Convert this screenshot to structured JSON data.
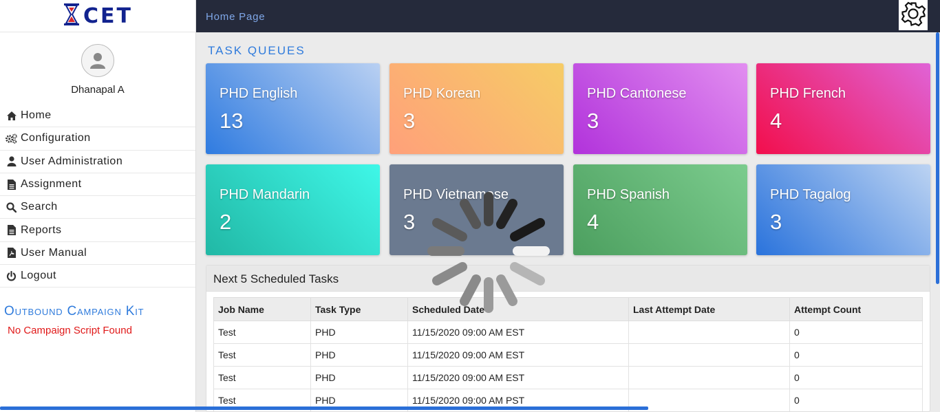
{
  "brand": {
    "name": "CET",
    "logo_icon": "hourglass-icon"
  },
  "profile": {
    "avatar_icon": "user-avatar-icon",
    "name": "Dhanapal A"
  },
  "menu": [
    {
      "label": "Home",
      "icon": "home-icon"
    },
    {
      "label": "Configuration",
      "icon": "cogs-icon"
    },
    {
      "label": "User Administration",
      "icon": "user-icon"
    },
    {
      "label": "Assignment",
      "icon": "file-icon"
    },
    {
      "label": "Search",
      "icon": "search-icon"
    },
    {
      "label": "Reports",
      "icon": "file-icon"
    },
    {
      "label": "User Manual",
      "icon": "pdf-file-icon"
    },
    {
      "label": "Logout",
      "icon": "power-icon"
    }
  ],
  "campaign": {
    "title": "Outbound Campaign Kit",
    "message": "No Campaign Script Found"
  },
  "topbar": {
    "title": "Home Page",
    "settings_icon": "gear-icon"
  },
  "task_queues": {
    "title": "TASK QUEUES",
    "cards": [
      {
        "label": "PHD English",
        "value": "13",
        "colors": [
          "#2f7be0",
          "#b9d0f2"
        ]
      },
      {
        "label": "PHD Korean",
        "value": "3",
        "colors": [
          "#ffa07a",
          "#f6cc66"
        ]
      },
      {
        "label": "PHD Cantonese",
        "value": "3",
        "colors": [
          "#b132db",
          "#e28ef0"
        ]
      },
      {
        "label": "PHD French",
        "value": "4",
        "colors": [
          "#f20e4c",
          "#e063d6"
        ]
      },
      {
        "label": "PHD Mandarin",
        "value": "2",
        "colors": [
          "#21b8a5",
          "#3ff7e8"
        ]
      },
      {
        "label": "PHD Vietnamese",
        "value": "3",
        "colors": [
          "#6b7a90",
          "#6b7a90"
        ]
      },
      {
        "label": "PHD Spanish",
        "value": "4",
        "colors": [
          "#4c9f5f",
          "#7ccc8e"
        ]
      },
      {
        "label": "PHD Tagalog",
        "value": "3",
        "colors": [
          "#2a73dc",
          "#bcd3f2"
        ]
      }
    ]
  },
  "scheduled": {
    "title": "Next 5 Scheduled Tasks",
    "columns": [
      "Job Name",
      "Task Type",
      "Scheduled Date",
      "Last Attempt Date",
      "Attempt Count"
    ],
    "rows": [
      [
        "Test",
        "PHD",
        "11/15/2020 09:00 AM EST",
        "",
        "0"
      ],
      [
        "Test",
        "PHD",
        "11/15/2020 09:00 AM EST",
        "",
        "0"
      ],
      [
        "Test",
        "PHD",
        "11/15/2020 09:00 AM EST",
        "",
        "0"
      ],
      [
        "Test",
        "PHD",
        "11/15/2020 09:00 AM PST",
        "",
        "0"
      ]
    ]
  },
  "loading_icon": "loading-spinner-icon"
}
